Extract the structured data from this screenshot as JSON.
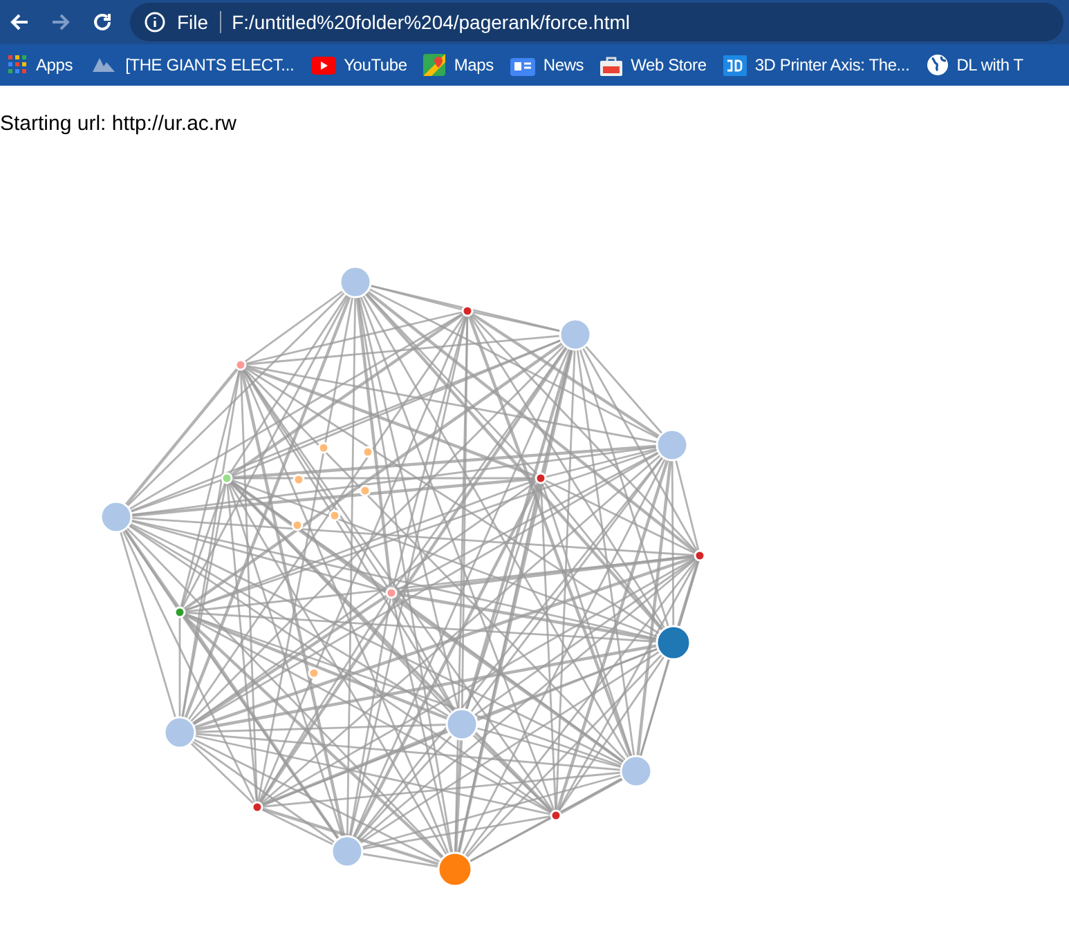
{
  "toolbar": {
    "back_disabled": false,
    "forward_disabled": true,
    "security_label": "File",
    "url": "F:/untitled%20folder%204/pagerank/force.html"
  },
  "bookmarks": [
    {
      "kind": "apps",
      "label": "Apps"
    },
    {
      "kind": "site",
      "label": "[THE GIANTS ELECT..."
    },
    {
      "kind": "youtube",
      "label": "YouTube"
    },
    {
      "kind": "maps",
      "label": "Maps"
    },
    {
      "kind": "news",
      "label": "News"
    },
    {
      "kind": "store",
      "label": "Web Store"
    },
    {
      "kind": "cube",
      "label": "3D Printer Axis: The..."
    },
    {
      "kind": "globe",
      "label": "DL with T"
    }
  ],
  "page": {
    "starting_url": "Starting url: http://ur.ac.rw"
  }
}
